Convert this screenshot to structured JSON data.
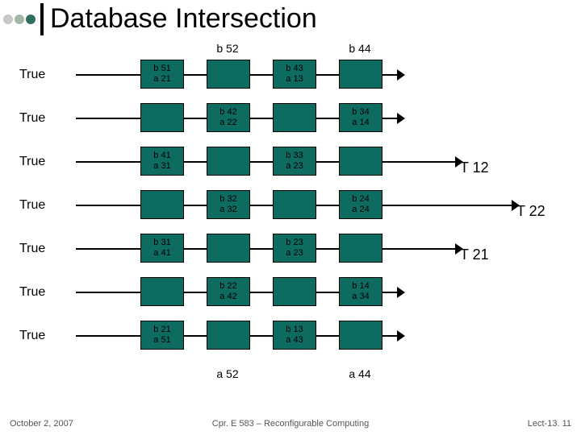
{
  "title": "Database Intersection",
  "columns": {
    "top": [
      "b 52",
      "b 44"
    ],
    "bottom": [
      "a 52",
      "a 44"
    ]
  },
  "tlabels": {
    "t12": "T 12",
    "t22": "T 22",
    "t21": "T 21"
  },
  "rows": [
    {
      "label": "True",
      "lineTo": 468,
      "cells": [
        {
          "l1": "b 51",
          "l2": "a 21"
        },
        {
          "blank": true
        },
        {
          "l1": "b 43",
          "l2": "a 13"
        },
        {
          "blank": true
        }
      ]
    },
    {
      "label": "True",
      "lineTo": 468,
      "cells": [
        {
          "blank": true
        },
        {
          "l1": "b 42",
          "l2": "a 22"
        },
        {
          "blank": true
        },
        {
          "l1": "b 34",
          "l2": "a 14"
        }
      ]
    },
    {
      "label": "True",
      "lineTo": 540,
      "cells": [
        {
          "l1": "b 41",
          "l2": "a 31"
        },
        {
          "blank": true
        },
        {
          "l1": "b 33",
          "l2": "a 23"
        },
        {
          "blank": true
        }
      ]
    },
    {
      "label": "True",
      "lineTo": 610,
      "cells": [
        {
          "blank": true
        },
        {
          "l1": "b 32",
          "l2": "a 32"
        },
        {
          "blank": true
        },
        {
          "l1": "b 24",
          "l2": "a 24"
        }
      ]
    },
    {
      "label": "True",
      "lineTo": 540,
      "cells": [
        {
          "l1": "b 31",
          "l2": "a 41"
        },
        {
          "blank": true
        },
        {
          "l1": "b 23",
          "l2": "a 23"
        },
        {
          "blank": true
        }
      ]
    },
    {
      "label": "True",
      "lineTo": 468,
      "cells": [
        {
          "blank": true
        },
        {
          "l1": "b 22",
          "l2": "a 42"
        },
        {
          "blank": true
        },
        {
          "l1": "b 14",
          "l2": "a 34"
        }
      ]
    },
    {
      "label": "True",
      "lineTo": 468,
      "cells": [
        {
          "l1": "b 21",
          "l2": "a 51"
        },
        {
          "blank": true
        },
        {
          "l1": "b 13",
          "l2": "a 43"
        },
        {
          "blank": true
        }
      ]
    }
  ],
  "footer": {
    "left": "October 2, 2007",
    "center": "Cpr. E 583 – Reconfigurable Computing",
    "right": "Lect-13. 11"
  },
  "chart_data": {
    "type": "table",
    "description": "7-stage systolic pipeline; each row labeled 'True' feeds through four cells (columns b52, b44 at top / a52, a44 at bottom). Labeled cells show paired b/a indices; blank cells are passthroughs. T12, T22, T21 annotate rows 3,4,5.",
    "rows": [
      [
        "b51/a21",
        "",
        "b43/a13",
        ""
      ],
      [
        "",
        "b42/a22",
        "",
        "b34/a14"
      ],
      [
        "b41/a31",
        "",
        "b33/a23",
        ""
      ],
      [
        "",
        "b32/a32",
        "",
        "b24/a24"
      ],
      [
        "b31/a41",
        "",
        "b23/a23",
        ""
      ],
      [
        "",
        "b22/a42",
        "",
        "b14/a34"
      ],
      [
        "b21/a51",
        "",
        "b13/a43",
        ""
      ]
    ],
    "row_annotations": {
      "2": "T12",
      "3": "T22",
      "4": "T21"
    }
  }
}
